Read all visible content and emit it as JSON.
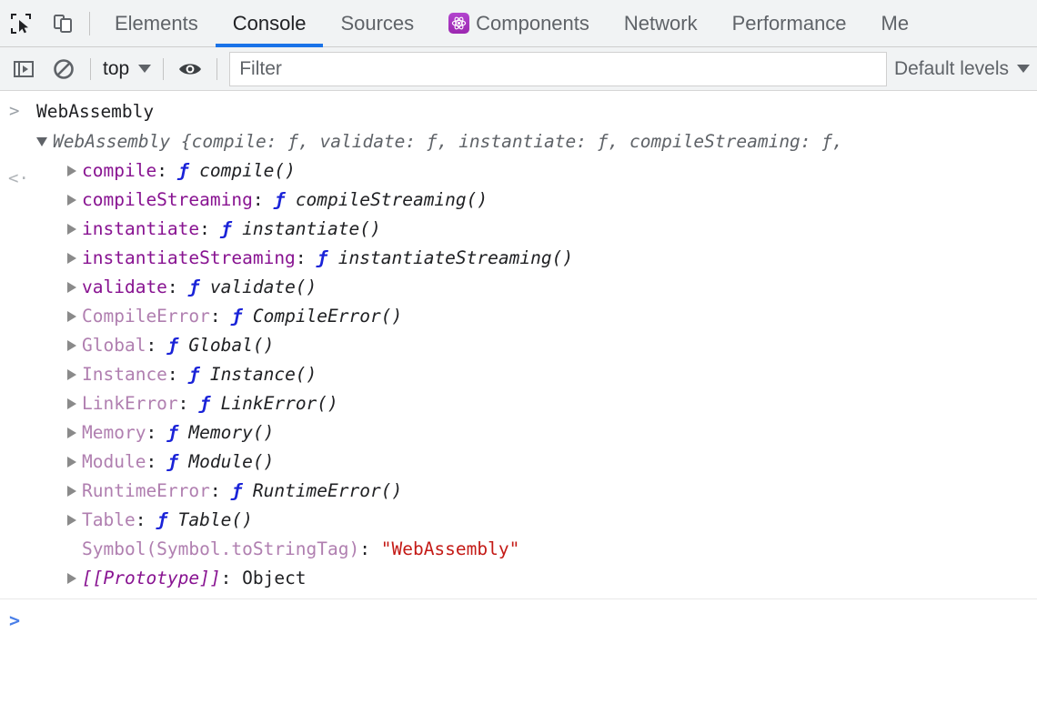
{
  "window": {
    "app": "Chrome DevTools",
    "background": "#ffffff",
    "toolbar_background": "#f1f3f4",
    "accent": "#1a73e8"
  },
  "tabbar": {
    "inspect_icon": "inspect-element-icon",
    "device_icon": "device-toolbar-icon",
    "tabs": [
      {
        "label": "Elements",
        "active": false,
        "icon": null
      },
      {
        "label": "Console",
        "active": true,
        "icon": null
      },
      {
        "label": "Sources",
        "active": false,
        "icon": null
      },
      {
        "label": "Components",
        "active": false,
        "icon": "react-components-icon"
      },
      {
        "label": "Network",
        "active": false,
        "icon": null
      },
      {
        "label": "Performance",
        "active": false,
        "icon": null
      },
      {
        "label": "Me",
        "active": false,
        "icon": null
      }
    ]
  },
  "console_toolbar": {
    "sidebar_toggle_icon": "console-sidebar-icon",
    "clear_icon": "clear-console-icon",
    "context": {
      "label": "top",
      "caret": "chevron-down-icon"
    },
    "eye_icon": "live-expression-eye-icon",
    "filter": {
      "placeholder": "Filter",
      "value": ""
    },
    "levels": {
      "label": "Default levels",
      "caret": "chevron-down-icon"
    }
  },
  "console": {
    "input": {
      "gutter": ">",
      "text": "WebAssembly"
    },
    "result": {
      "gutter": "<·",
      "summary": "WebAssembly {compile: ƒ, validate: ƒ, instantiate: ƒ, compileStreaming: ƒ,",
      "properties": [
        {
          "key": "compile",
          "key_style": "own",
          "value_fn": "compile()",
          "expandable": true
        },
        {
          "key": "compileStreaming",
          "key_style": "own",
          "value_fn": "compileStreaming()",
          "expandable": true
        },
        {
          "key": "instantiate",
          "key_style": "own",
          "value_fn": "instantiate()",
          "expandable": true
        },
        {
          "key": "instantiateStreaming",
          "key_style": "own",
          "value_fn": "instantiateStreaming()",
          "expandable": true
        },
        {
          "key": "validate",
          "key_style": "own",
          "value_fn": "validate()",
          "expandable": true
        },
        {
          "key": "CompileError",
          "key_style": "dim",
          "value_fn": "CompileError()",
          "expandable": true
        },
        {
          "key": "Global",
          "key_style": "dim",
          "value_fn": "Global()",
          "expandable": true
        },
        {
          "key": "Instance",
          "key_style": "dim",
          "value_fn": "Instance()",
          "expandable": true
        },
        {
          "key": "LinkError",
          "key_style": "dim",
          "value_fn": "LinkError()",
          "expandable": true
        },
        {
          "key": "Memory",
          "key_style": "dim",
          "value_fn": "Memory()",
          "expandable": true
        },
        {
          "key": "Module",
          "key_style": "dim",
          "value_fn": "Module()",
          "expandable": true
        },
        {
          "key": "RuntimeError",
          "key_style": "dim",
          "value_fn": "RuntimeError()",
          "expandable": true
        },
        {
          "key": "Table",
          "key_style": "dim",
          "value_fn": "Table()",
          "expandable": true
        },
        {
          "key": "Symbol(Symbol.toStringTag)",
          "key_style": "dim",
          "value_string": "\"WebAssembly\"",
          "expandable": false
        },
        {
          "key": "[[Prototype]]",
          "key_style": "proto",
          "value_plain": "Object",
          "expandable": true
        }
      ]
    },
    "prompt": {
      "caret": ">",
      "value": ""
    }
  },
  "colors": {
    "own_key": "#881391",
    "dim_key": "#b07fb0",
    "function_keyword": "#1a23d8",
    "string_value": "#c41a16",
    "text": "#202124",
    "muted": "#5f6368"
  }
}
